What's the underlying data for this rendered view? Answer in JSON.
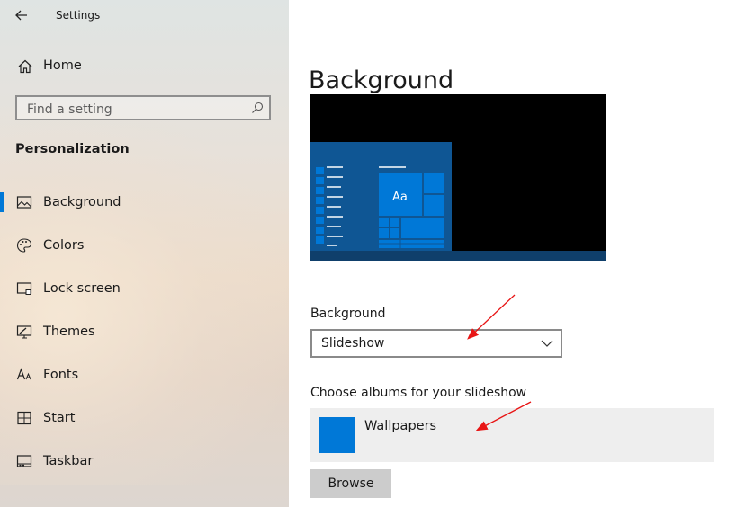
{
  "window": {
    "title": "Settings"
  },
  "sidebar": {
    "home_label": "Home",
    "search_placeholder": "Find a setting",
    "section_title": "Personalization",
    "items": [
      {
        "label": "Background",
        "icon": "picture-icon",
        "selected": true
      },
      {
        "label": "Colors",
        "icon": "palette-icon",
        "selected": false
      },
      {
        "label": "Lock screen",
        "icon": "lock-screen-icon",
        "selected": false
      },
      {
        "label": "Themes",
        "icon": "themes-icon",
        "selected": false
      },
      {
        "label": "Fonts",
        "icon": "fonts-icon",
        "selected": false
      },
      {
        "label": "Start",
        "icon": "start-icon",
        "selected": false
      },
      {
        "label": "Taskbar",
        "icon": "taskbar-icon",
        "selected": false
      }
    ]
  },
  "main": {
    "title": "Background",
    "preview": {
      "tile_label": "Aa"
    },
    "background_field": {
      "label": "Background",
      "value": "Slideshow"
    },
    "albums": {
      "label": "Choose albums for your slideshow",
      "items": [
        {
          "name": "Wallpapers"
        }
      ]
    },
    "browse_label": "Browse"
  },
  "colors": {
    "accent": "#0078d7",
    "preview_start": "#0f5694",
    "annotation_arrow": "#e81515"
  }
}
